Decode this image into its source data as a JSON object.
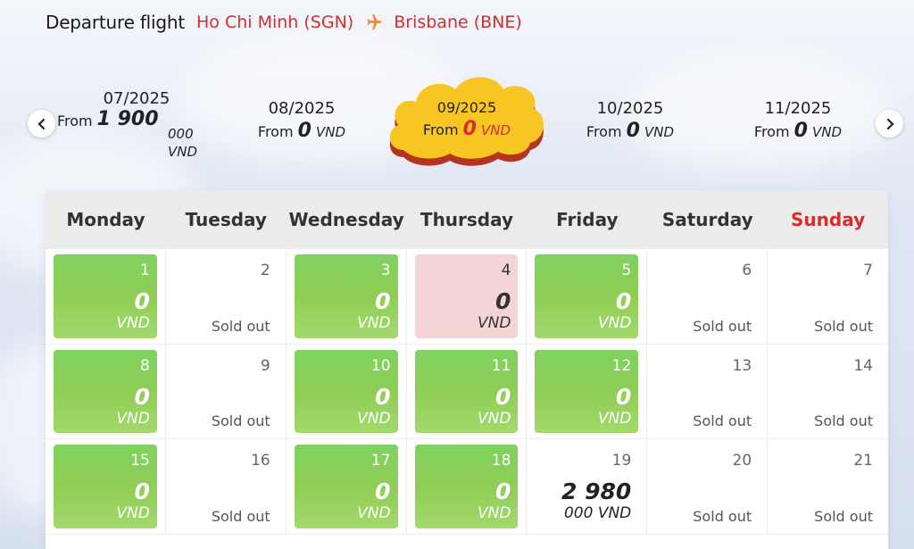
{
  "header": {
    "title": "Departure flight",
    "from": "Ho Chi Minh (SGN)",
    "to": "Brisbane (BNE)",
    "icon": "airplane-icon",
    "accent": "#d32f2f"
  },
  "months": [
    {
      "label": "07/2025",
      "from": "From",
      "amount": "1 900",
      "currency_line1": "000",
      "currency_line2": "VND"
    },
    {
      "label": "08/2025",
      "from": "From",
      "amount": "0",
      "currency": "VND"
    },
    {
      "label": "09/2025",
      "from": "From",
      "amount": "0",
      "currency": "VND",
      "active": true
    },
    {
      "label": "10/2025",
      "from": "From",
      "amount": "0",
      "currency": "VND"
    },
    {
      "label": "11/2025",
      "from": "From",
      "amount": "0",
      "currency": "VND"
    }
  ],
  "nav": {
    "prev_icon": "chevron-left-icon",
    "next_icon": "chevron-right-icon"
  },
  "weekdays": [
    "Monday",
    "Tuesday",
    "Wednesday",
    "Thursday",
    "Friday",
    "Saturday",
    "Sunday"
  ],
  "days": [
    {
      "day": "1",
      "type": "green",
      "price": "0",
      "currency": "VND"
    },
    {
      "day": "2",
      "type": "white",
      "status": "Sold out"
    },
    {
      "day": "3",
      "type": "green",
      "price": "0",
      "currency": "VND"
    },
    {
      "day": "4",
      "type": "pink",
      "price": "0",
      "currency": "VND"
    },
    {
      "day": "5",
      "type": "green",
      "price": "0",
      "currency": "VND"
    },
    {
      "day": "6",
      "type": "white",
      "status": "Sold out"
    },
    {
      "day": "7",
      "type": "white",
      "status": "Sold out"
    },
    {
      "day": "8",
      "type": "green",
      "price": "0",
      "currency": "VND"
    },
    {
      "day": "9",
      "type": "white",
      "status": "Sold out"
    },
    {
      "day": "10",
      "type": "green",
      "price": "0",
      "currency": "VND"
    },
    {
      "day": "11",
      "type": "green",
      "price": "0",
      "currency": "VND"
    },
    {
      "day": "12",
      "type": "green",
      "price": "0",
      "currency": "VND"
    },
    {
      "day": "13",
      "type": "white",
      "status": "Sold out"
    },
    {
      "day": "14",
      "type": "white",
      "status": "Sold out"
    },
    {
      "day": "15",
      "type": "green",
      "price": "0",
      "currency": "VND"
    },
    {
      "day": "16",
      "type": "white",
      "status": "Sold out"
    },
    {
      "day": "17",
      "type": "green",
      "price": "0",
      "currency": "VND"
    },
    {
      "day": "18",
      "type": "green",
      "price": "0",
      "currency": "VND"
    },
    {
      "day": "19",
      "type": "special",
      "price": "2 980",
      "currency": "000 VND"
    },
    {
      "day": "20",
      "type": "white",
      "status": "Sold out"
    },
    {
      "day": "21",
      "type": "white",
      "status": "Sold out"
    }
  ],
  "colors": {
    "green": "#8fcd55",
    "pink": "#f5d4d5",
    "active_month": "#f7c623",
    "sunday": "#d32f2f"
  }
}
